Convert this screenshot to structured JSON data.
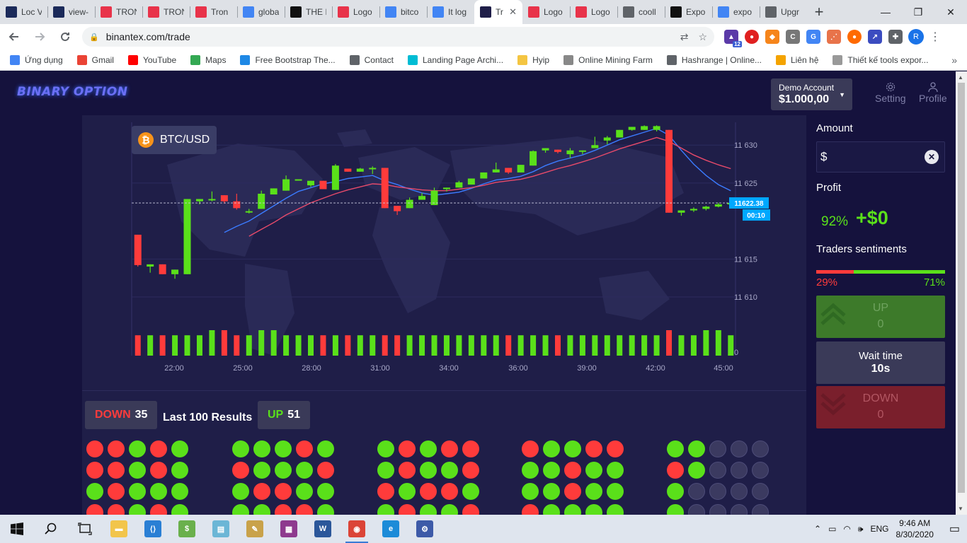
{
  "browser": {
    "tabs": [
      {
        "title": "Loc V",
        "icon": "blue-square",
        "color": "#1b2a5a"
      },
      {
        "title": "view-",
        "icon": "blue-square",
        "color": "#1b2a5a"
      },
      {
        "title": "TRON",
        "icon": "tron-logo",
        "color": "#e8334a"
      },
      {
        "title": "TRON",
        "icon": "cube-logo",
        "color": "#e8334a"
      },
      {
        "title": "Tron",
        "icon": "tron-logo",
        "color": "#e8334a"
      },
      {
        "title": "globa",
        "icon": "google-g",
        "color": "#4285f4"
      },
      {
        "title": "THE I",
        "icon": "medium-m",
        "color": "#111111"
      },
      {
        "title": "Logo",
        "icon": "flame-logo",
        "color": "#e8334a"
      },
      {
        "title": "bitco",
        "icon": "google-g",
        "color": "#4285f4"
      },
      {
        "title": "It log",
        "icon": "google-g",
        "color": "#4285f4"
      },
      {
        "title": "Tr",
        "icon": "binary-logo",
        "color": "#1f1e48",
        "active": true
      },
      {
        "title": "Logo",
        "icon": "flame-logo",
        "color": "#e8334a"
      },
      {
        "title": "Logo",
        "icon": "flame-logo",
        "color": "#e8334a"
      },
      {
        "title": "cooll",
        "icon": "globe-icon",
        "color": "#5f6368"
      },
      {
        "title": "Expo",
        "icon": "github-icon",
        "color": "#111111"
      },
      {
        "title": "expo",
        "icon": "google-g",
        "color": "#4285f4"
      },
      {
        "title": "Upgr",
        "icon": "upgrade-icon",
        "color": "#5f6368"
      }
    ],
    "new_tab": "+",
    "window_controls": [
      "—",
      "❐",
      "✕"
    ],
    "url": "binantex.com/trade",
    "profile_initial": "R",
    "extension_badge": "12",
    "bookmarks": [
      {
        "label": "Ứng dụng",
        "icon": "apps-grid",
        "color": "#4285f4"
      },
      {
        "label": "Gmail",
        "icon": "gmail-m",
        "color": "#ea4335"
      },
      {
        "label": "YouTube",
        "icon": "youtube-play",
        "color": "#ff0000"
      },
      {
        "label": "Maps",
        "icon": "maps-pin",
        "color": "#34a853"
      },
      {
        "label": "Free Bootstrap The...",
        "icon": "bootstrap-icon",
        "color": "#1e88e5"
      },
      {
        "label": "Contact",
        "icon": "globe-icon",
        "color": "#5f6368"
      },
      {
        "label": "Landing Page Archi...",
        "icon": "arrow-icon",
        "color": "#00bcd4"
      },
      {
        "label": "Hyip",
        "icon": "folder-icon",
        "color": "#f4c542"
      },
      {
        "label": "Online Mining Farm",
        "icon": "fan-icon",
        "color": "#888888"
      },
      {
        "label": "Hashrange | Online...",
        "icon": "globe-icon",
        "color": "#5f6368"
      },
      {
        "label": "Liên hệ",
        "icon": "play-icon",
        "color": "#f4a300"
      },
      {
        "label": "Thiết kế tools expor...",
        "icon": "feather-icon",
        "color": "#999999"
      }
    ],
    "bookmarks_more": "»"
  },
  "app": {
    "logo_text": "BINARY OPTION",
    "account": {
      "label": "Demo Account",
      "balance": "$1.000,00"
    },
    "nav": [
      {
        "label": "Setting",
        "icon": "gear-icon"
      },
      {
        "label": "Profile",
        "icon": "user-icon"
      }
    ],
    "pair": {
      "symbol": "BTC/USD",
      "icon": "bitcoin-icon",
      "icon_glyph": "₿"
    },
    "price_tag": "11622.38",
    "timer_tag": "00:10",
    "colors": {
      "up": "#5ae01a",
      "down": "#ff3b3b",
      "ma_fast": "#3b7bff",
      "ma_slow": "#e84a6a",
      "tag": "#00a8ff"
    },
    "sidebar": {
      "amount_label": "Amount",
      "currency": "$",
      "amount_value": "",
      "clear_icon": "close-icon",
      "profit_label": "Profit",
      "profit_pct": "92%",
      "profit_value": "+$0",
      "sentiment_label": "Traders sentiments",
      "sentiment_down": "29%",
      "sentiment_up": "71%",
      "sentiment_down_fraction": 0.29,
      "up_label": "UP",
      "up_value": "0",
      "wait_label": "Wait time",
      "wait_value": "10s",
      "down_label": "DOWN",
      "down_value": "0"
    },
    "results": {
      "down_label": "DOWN",
      "down_count": "35",
      "title": "Last 100 Results",
      "up_label": "UP",
      "up_count": "51",
      "groups": [
        [
          "r",
          "r",
          "g",
          "r",
          "g",
          "r",
          "r",
          "g",
          "r",
          "g",
          "g",
          "r",
          "g",
          "g",
          "g",
          "r",
          "r",
          "g",
          "r",
          "g"
        ],
        [
          "g",
          "g",
          "g",
          "r",
          "g",
          "r",
          "g",
          "g",
          "g",
          "r",
          "g",
          "r",
          "r",
          "g",
          "g",
          "g",
          "g",
          "r",
          "r",
          "g"
        ],
        [
          "g",
          "r",
          "g",
          "r",
          "r",
          "g",
          "r",
          "g",
          "g",
          "r",
          "r",
          "g",
          "r",
          "r",
          "g",
          "g",
          "r",
          "g",
          "g",
          "r"
        ],
        [
          "r",
          "g",
          "g",
          "r",
          "r",
          "g",
          "g",
          "r",
          "g",
          "g",
          "g",
          "g",
          "r",
          "g",
          "g",
          "r",
          "g",
          "g",
          "g",
          "g"
        ],
        [
          "g",
          "g",
          "e",
          "e",
          "e",
          "r",
          "g",
          "e",
          "e",
          "e",
          "g",
          "e",
          "e",
          "e",
          "e",
          "g",
          "e",
          "e",
          "e",
          "e"
        ]
      ]
    }
  },
  "chart_data": {
    "type": "candlestick",
    "y_ticks": [
      11630,
      11625,
      11615,
      11610,
      0
    ],
    "y_tick_labels": [
      "11 630",
      "11 625",
      "11 615",
      "11 610",
      "0"
    ],
    "x_tick_labels": [
      "22:00",
      "25:00",
      "28:00",
      "31:00",
      "34:00",
      "36:00",
      "39:00",
      "42:00",
      "45:00"
    ],
    "ylim": [
      11606,
      11633
    ],
    "current_price": 11622.38,
    "candles": [
      [
        11618.2,
        11618.2,
        11614.2,
        11614.0
      ],
      [
        11614.0,
        11614.3,
        11614.3,
        11613.2
      ],
      [
        11614.3,
        11614.3,
        11613.0,
        11613.0
      ],
      [
        11613.0,
        11613.6,
        11613.6,
        11612.4
      ],
      [
        11613.0,
        11622.9,
        11622.9,
        11613.0
      ],
      [
        11622.6,
        11622.6,
        11622.9,
        11622.2
      ],
      [
        11622.9,
        11623.9,
        11622.9,
        11622.6
      ],
      [
        11623.4,
        11623.4,
        11622.6,
        11622.3
      ],
      [
        11622.6,
        11623.6,
        11621.7,
        11621.5
      ],
      [
        11621.3,
        11621.6,
        11621.3,
        11621.0
      ],
      [
        11621.6,
        11624.0,
        11623.6,
        11621.6
      ],
      [
        11623.5,
        11624.3,
        11624.3,
        11623.5
      ],
      [
        11624.0,
        11626.0,
        11625.5,
        11624.0
      ],
      [
        11625.5,
        11625.5,
        11625.5,
        11625.5
      ],
      [
        11624.7,
        11625.3,
        11625.3,
        11624.5
      ],
      [
        11625.3,
        11625.3,
        11624.2,
        11624.2
      ],
      [
        11624.1,
        11627.5,
        11627.3,
        11624.1
      ],
      [
        11626.9,
        11626.9,
        11626.5,
        11626.5
      ],
      [
        11626.5,
        11627.0,
        11626.9,
        11626.5
      ],
      [
        11626.9,
        11627.2,
        11627.0,
        11626.2
      ],
      [
        11627.0,
        11627.0,
        11621.7,
        11621.7
      ],
      [
        11622.0,
        11622.0,
        11621.3,
        11620.8
      ],
      [
        11621.7,
        11623.1,
        11622.8,
        11621.7
      ],
      [
        11622.8,
        11623.7,
        11623.3,
        11622.8
      ],
      [
        11622.1,
        11624.4,
        11624.0,
        11622.1
      ],
      [
        11624.2,
        11624.4,
        11624.4,
        11623.9
      ],
      [
        11624.4,
        11625.3,
        11625.1,
        11624.4
      ],
      [
        11624.8,
        11625.6,
        11625.6,
        11624.8
      ],
      [
        11625.6,
        11626.4,
        11626.4,
        11625.6
      ],
      [
        11626.4,
        11627.7,
        11626.8,
        11626.4
      ],
      [
        11627.0,
        11627.0,
        11626.4,
        11626.2
      ],
      [
        11626.4,
        11627.4,
        11627.4,
        11626.4
      ],
      [
        11627.3,
        11629.3,
        11629.2,
        11627.3
      ],
      [
        11629.3,
        11629.6,
        11629.6,
        11629.0
      ],
      [
        11629.4,
        11629.4,
        11629.1,
        11628.9
      ],
      [
        11628.8,
        11629.6,
        11629.3,
        11628.3
      ],
      [
        11629.3,
        11629.3,
        11629.3,
        11628.8
      ],
      [
        11629.6,
        11631.1,
        11630.0,
        11629.6
      ],
      [
        11630.6,
        11631.2,
        11631.0,
        11630.1
      ],
      [
        11631.0,
        11632.0,
        11632.0,
        11631.0
      ],
      [
        11632.0,
        11632.4,
        11632.4,
        11631.9
      ],
      [
        11632.0,
        11632.6,
        11632.5,
        11632.2
      ],
      [
        11632.0,
        11632.6,
        11632.5,
        11631.8
      ],
      [
        11632.0,
        11632.0,
        11621.1,
        11621.1
      ],
      [
        11621.1,
        11621.4,
        11621.4,
        11620.7
      ],
      [
        11621.4,
        11621.8,
        11621.6,
        11621.2
      ],
      [
        11621.6,
        11622.0,
        11621.9,
        11621.4
      ],
      [
        11621.9,
        11622.4,
        11622.2,
        11621.8
      ],
      [
        11622.2,
        11622.6,
        11622.38,
        11622.0
      ]
    ],
    "volume": [
      4,
      4,
      4,
      4,
      4,
      4,
      5,
      5,
      4,
      4,
      5,
      5,
      4,
      4,
      4,
      4,
      4,
      4,
      4,
      4,
      4,
      4,
      4,
      4,
      4,
      4,
      4,
      4,
      4,
      4,
      4,
      4,
      4,
      4,
      4,
      4,
      4,
      4,
      4,
      4,
      4,
      4,
      4,
      5,
      4,
      4,
      5,
      5,
      4
    ],
    "ma_fast": [
      null,
      null,
      null,
      null,
      null,
      null,
      null,
      11618.5,
      11619.3,
      11620.0,
      11621.0,
      11622.0,
      11623.0,
      11623.9,
      11624.4,
      11624.9,
      11625.2,
      11625.6,
      11625.8,
      11626.0,
      11625.3,
      11624.8,
      11624.2,
      11623.7,
      11623.4,
      11623.6,
      11623.8,
      11624.3,
      11624.9,
      11625.4,
      11625.6,
      11625.9,
      11626.5,
      11627.3,
      11627.9,
      11628.3,
      11628.7,
      11629.3,
      11630.0,
      11630.7,
      11631.2,
      11631.7,
      11632.2,
      11631.3,
      11629.3,
      11627.5,
      11626.0,
      11624.8,
      11624.0
    ],
    "ma_slow": [
      null,
      null,
      null,
      null,
      null,
      null,
      null,
      null,
      null,
      11618.0,
      11618.9,
      11619.8,
      11620.8,
      11621.6,
      11622.4,
      11623.0,
      11623.6,
      11624.1,
      11624.5,
      11624.9,
      11624.8,
      11624.5,
      11624.3,
      11624.1,
      11624.0,
      11624.0,
      11624.2,
      11624.4,
      11624.7,
      11625.1,
      11625.3,
      11625.5,
      11625.9,
      11626.4,
      11626.9,
      11627.3,
      11627.8,
      11628.3,
      11628.9,
      11629.5,
      11630.0,
      11630.5,
      11631.0,
      11630.5,
      11629.6,
      11628.7,
      11628.0,
      11627.4,
      11626.9
    ]
  },
  "taskbar": {
    "apps": [
      {
        "name": "file-explorer-icon",
        "color": "#f2c54b",
        "glyph": "▬"
      },
      {
        "name": "vscode-icon",
        "color": "#2a7fd4",
        "glyph": "⟨⟩"
      },
      {
        "name": "money-app-icon",
        "color": "#6ab04c",
        "glyph": "$"
      },
      {
        "name": "notes-app-icon",
        "color": "#6bb6d6",
        "glyph": "▤"
      },
      {
        "name": "paint-icon",
        "color": "#c9a24a",
        "glyph": "✎"
      },
      {
        "name": "winrar-icon",
        "color": "#8e3a8e",
        "glyph": "▦"
      },
      {
        "name": "word-icon",
        "color": "#2b579a",
        "glyph": "W"
      },
      {
        "name": "chrome-icon",
        "color": "#db4437",
        "glyph": "◉"
      },
      {
        "name": "edge-icon",
        "color": "#1c8bd8",
        "glyph": "e"
      },
      {
        "name": "network-tool-icon",
        "color": "#3d5aa8",
        "glyph": "⚙"
      }
    ],
    "lang": "ENG",
    "time": "9:46 AM",
    "date": "8/30/2020"
  }
}
